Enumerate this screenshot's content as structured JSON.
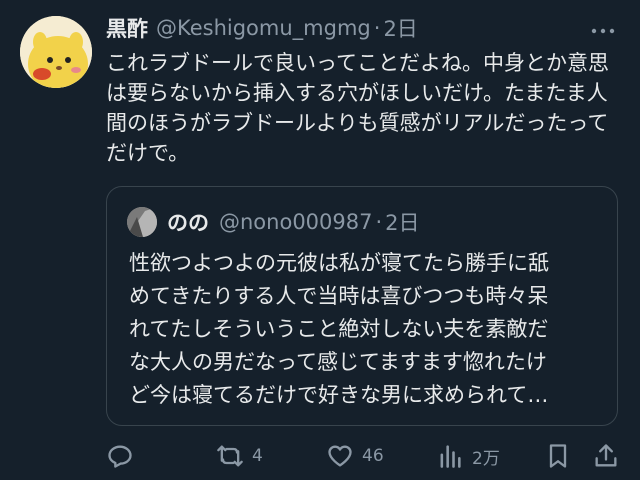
{
  "tweet": {
    "display_name": "黒酢",
    "handle": "@Keshigomu_mgmg",
    "separator": "·",
    "time": "2日",
    "text": "これラブドールで良いってことだよね。中身とか意思は要らないから挿入する穴がほしいだけ。たまたま人間のほうがラブドールよりも質感がリアルだったってだけで。",
    "avatar_icon": "yellow-mascot-avatar",
    "more_icon": "more-dots-icon"
  },
  "quote": {
    "display_name": "のの",
    "handle": "@nono000987",
    "separator": "·",
    "time": "2日",
    "text_lines": [
      "性欲つよつよの元彼は私が寝てたら勝手に舐",
      "めてきたりする人で当時は喜びつつも時々呆",
      "れてたしそういうこと絶対しない夫を素敵だ",
      "な大人の男だなって感じてますます惚れたけ",
      "ど今は寝てるだけで好きな男に求められて…"
    ]
  },
  "actions": {
    "reply_count": "",
    "retweet_count": "4",
    "like_count": "46",
    "views_count": "2万"
  },
  "colors": {
    "background": "#15202b",
    "text": "#e7e9ea",
    "muted": "#8b98a5",
    "border": "#38444d"
  }
}
